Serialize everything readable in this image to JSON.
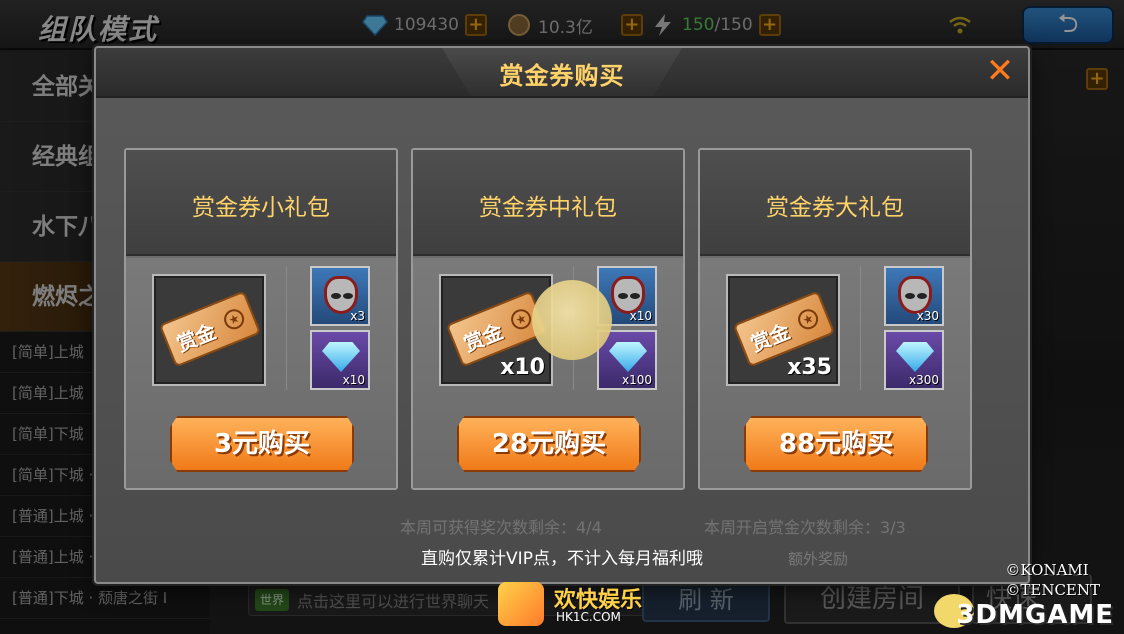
{
  "background": {
    "mode_title": "组队模式",
    "resources": {
      "diamonds": "109430",
      "gold": "10.3亿",
      "energy_current": "150",
      "energy_sep": "/",
      "energy_max": "150"
    },
    "sidebar": {
      "categories": [
        {
          "label": "全部关"
        },
        {
          "label": "经典组"
        },
        {
          "label": "水下八"
        },
        {
          "label": "燃烬之"
        }
      ],
      "rooms": [
        "[简单]上城",
        "[简单]上城",
        "[简单]下城",
        "[简单]下城 · 燃烬之街 II",
        "[普通]上城 · 全息时代 I",
        "[普通]上城 · 全息时代 II",
        "[普通]下城 · 颓唐之街 I"
      ]
    },
    "bottom": {
      "world_tag": "世界",
      "world_text": "点击这里可以进行世界聊天",
      "refresh": "刷 新",
      "create_room": "创建房间",
      "quick_join": "快速"
    }
  },
  "modal": {
    "title": "赏金券购买",
    "packs": [
      {
        "name": "赏金券小礼包",
        "ticket_label": "赏金",
        "ticket_qty": "",
        "mask_qty": "x3",
        "gem_qty": "x10",
        "buy_label": "3元购买"
      },
      {
        "name": "赏金券中礼包",
        "ticket_label": "赏金",
        "ticket_qty": "x10",
        "mask_qty": "x10",
        "gem_qty": "x100",
        "buy_label": "28元购买"
      },
      {
        "name": "赏金券大礼包",
        "ticket_label": "赏金",
        "ticket_qty": "x35",
        "mask_qty": "x30",
        "gem_qty": "x300",
        "buy_label": "88元购买"
      }
    ],
    "faded_left": "本周可获得奖次数剩余：4/4",
    "faded_right": "本周开启赏金次数剩余：3/3",
    "faded_extra": "额外奖励",
    "note": "直购仅累计VIP点，不计入每月福利哦"
  },
  "watermark": {
    "copyright_line1": "©KONAMI",
    "copyright_line2": "©TENCENT",
    "brand": "3DMGAME",
    "hk_cn": "欢快娱乐",
    "hk_url": "HK1C.COM"
  },
  "colors": {
    "title_gold": "#ffd36a",
    "close_orange": "#ff7a1a",
    "buy_orange": "#f07a18",
    "energy_green": "#5fd35f"
  }
}
